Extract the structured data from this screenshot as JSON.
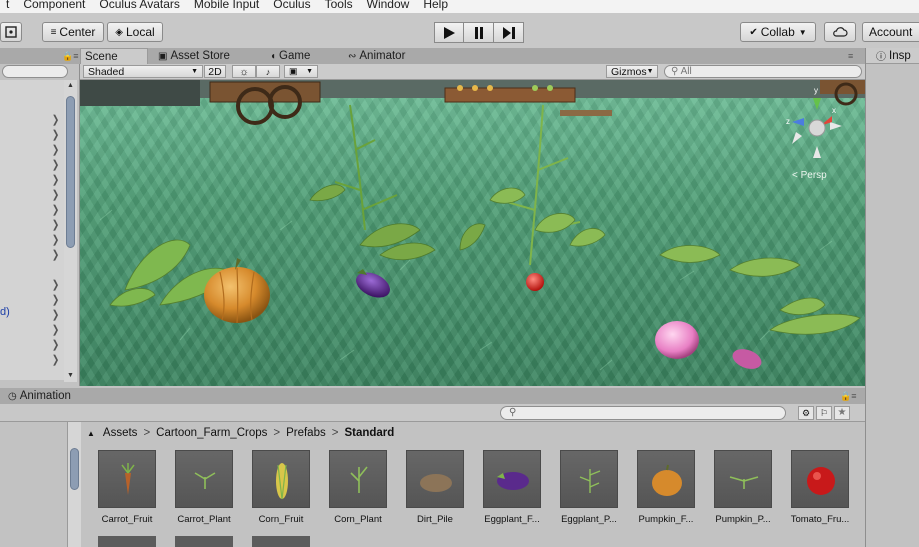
{
  "menu": [
    "t",
    "Component",
    "Oculus Avatars",
    "Mobile Input",
    "Oculus",
    "Tools",
    "Window",
    "Help"
  ],
  "toolbar": {
    "pivot_label": "Center",
    "space_label": "Local",
    "collab_label": "Collab",
    "account_label": "Account"
  },
  "tabs": {
    "scene": "Scene",
    "asset_store": "Asset Store",
    "game": "Game",
    "animator": "Animator",
    "inspector": "Insp"
  },
  "scene_toolbar": {
    "shading": "Shaded",
    "mode_2d": "2D",
    "gizmos": "Gizmos",
    "search_placeholder": "All",
    "persp_label": "< Persp",
    "gizmo_axes": {
      "x": "x",
      "y": "y",
      "z": "z"
    }
  },
  "hierarchy": {
    "partial_text": "d)"
  },
  "bottom": {
    "tab_label": "Animation",
    "breadcrumb": [
      "Assets",
      "Cartoon_Farm_Crops",
      "Prefabs",
      "Standard"
    ],
    "assets": [
      {
        "label": "Carrot_Fruit",
        "icon": "carrot-icon"
      },
      {
        "label": "Carrot_Plant",
        "icon": "sprout-icon"
      },
      {
        "label": "Corn_Fruit",
        "icon": "corn-icon"
      },
      {
        "label": "Corn_Plant",
        "icon": "sprout-icon"
      },
      {
        "label": "Dirt_Pile",
        "icon": "dirt-icon"
      },
      {
        "label": "Eggplant_F...",
        "icon": "eggplant-icon"
      },
      {
        "label": "Eggplant_P...",
        "icon": "sprout-icon"
      },
      {
        "label": "Pumpkin_F...",
        "icon": "pumpkin-icon"
      },
      {
        "label": "Pumpkin_P...",
        "icon": "sprout-icon"
      },
      {
        "label": "Tomato_Fru...",
        "icon": "tomato-icon"
      }
    ]
  },
  "colors": {
    "editor_bg": "#c2c2c2",
    "scene_ground": "#4f9e76",
    "selection": "#8d9db3"
  }
}
